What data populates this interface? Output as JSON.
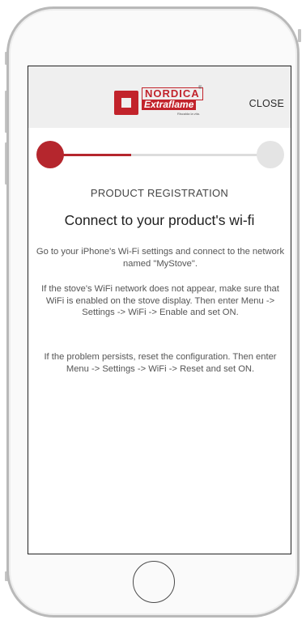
{
  "header": {
    "logo": {
      "brand_top": "NORDICA",
      "brand_bottom": "Extraflame",
      "tagline": "Riscalda la vita.",
      "registered": "®"
    },
    "close_label": "CLOSE"
  },
  "progress": {
    "current_step": 1,
    "total_steps": 2,
    "fill_fraction": 0.37,
    "active_color": "#b5262d",
    "inactive_color": "#e4e4e4"
  },
  "content": {
    "step_title": "PRODUCT REGISTRATION",
    "main_title": "Connect to your product's wi-fi",
    "paragraph_1": "Go to your iPhone's Wi-Fi settings and connect to the network named \"MyStove\".",
    "paragraph_2": "If the stove's WiFi network does not appear, make sure that WiFi is enabled on the stove display. Then enter Menu -> Settings -> WiFi -> Enable and set ON.",
    "paragraph_3": "If the problem persists, reset the configuration. Then enter Menu -> Settings -> WiFi -> Reset and set ON."
  },
  "device": {
    "home_button_icon": "home-button-ring"
  }
}
